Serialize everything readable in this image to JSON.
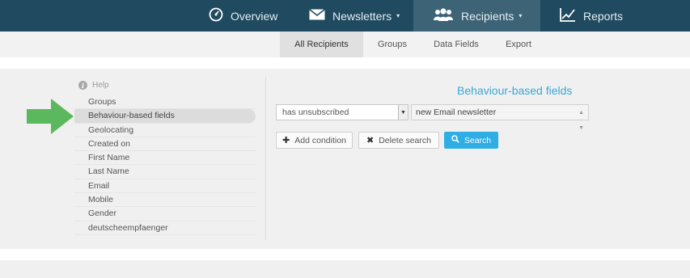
{
  "topnav": {
    "items": [
      {
        "label": "Overview",
        "icon": "speedometer-icon"
      },
      {
        "label": "Newsletters",
        "icon": "envelope-icon",
        "has_caret": true
      },
      {
        "label": "Recipients",
        "icon": "users-icon",
        "has_caret": true,
        "active": true
      },
      {
        "label": "Reports",
        "icon": "chart-icon"
      }
    ],
    "caret": "▾"
  },
  "subnav": {
    "items": [
      {
        "label": "All Recipients",
        "active": true
      },
      {
        "label": "Groups"
      },
      {
        "label": "Data Fields"
      },
      {
        "label": "Export"
      }
    ]
  },
  "sidebar": {
    "help_label": "Help",
    "fields": [
      "Groups",
      "Behaviour-based fields",
      "Geolocating",
      "Created on",
      "First Name",
      "Last Name",
      "Email",
      "Mobile",
      "Gender",
      "deutscheempfaenger"
    ],
    "active_index": 1
  },
  "main": {
    "title": "Behaviour-based fields",
    "condition_select": "has unsubscribed",
    "newsletter_select": "new Email newsletter",
    "add_condition": "Add condition",
    "delete_search": "Delete search",
    "search": "Search"
  },
  "colors": {
    "nav_bg": "#1f4a5f",
    "nav_active": "#3d6376",
    "accent": "#2eaee4",
    "title": "#3aa7d6",
    "arrow": "#5cb85c"
  }
}
